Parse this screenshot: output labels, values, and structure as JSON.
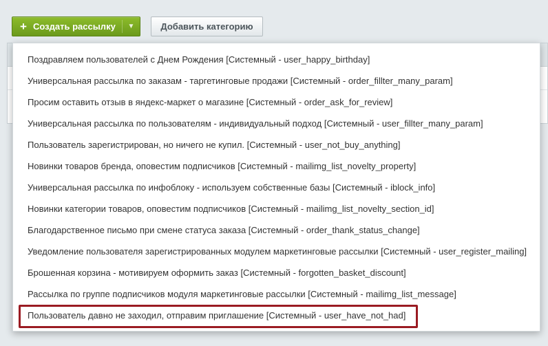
{
  "toolbar": {
    "create_label": "Создать рассылку",
    "category_label": "Добавить категорию"
  },
  "menu": {
    "items": [
      "Поздравляем пользователей с Днем Рождения [Системный - user_happy_birthday]",
      "Универсальная рассылка по заказам - таргетинговые продажи [Системный - order_fillter_many_param]",
      "Просим оставить отзыв в яндекс-маркет о магазине [Системный - order_ask_for_review]",
      "Универсальная рассылка по пользователям - индивидуальный подход [Системный - user_fillter_many_param]",
      "Пользователь зарегистрирован, но ничего не купил. [Системный - user_not_buy_anything]",
      "Новинки товаров бренда, оповестим подписчиков [Системный - mailimg_list_novelty_property]",
      "Универсальная рассылка по инфоблоку - используем собственные базы [Системный - iblock_info]",
      "Новинки категории товаров, оповестим подписчиков [Системный - mailimg_list_novelty_section_id]",
      "Благодарственное письмо при смене статуса заказа [Системный - order_thank_status_change]",
      "Уведомление пользователя зарегистрированных модулем маркетинговые рассылки [Системный - user_register_mailing]",
      "Брошенная корзина - мотивируем оформить заказ [Системный - forgotten_basket_discount]",
      "Рассылка по группе подписчиков модуля маркетинговые рассылки [Системный - mailimg_list_message]",
      "Пользователь давно не заходил, отправим приглашение [Системный - user_have_not_had]"
    ]
  },
  "colors": {
    "accent_green": "#7aab23",
    "highlight": "#9a1b22",
    "background": "#e5eaed"
  }
}
